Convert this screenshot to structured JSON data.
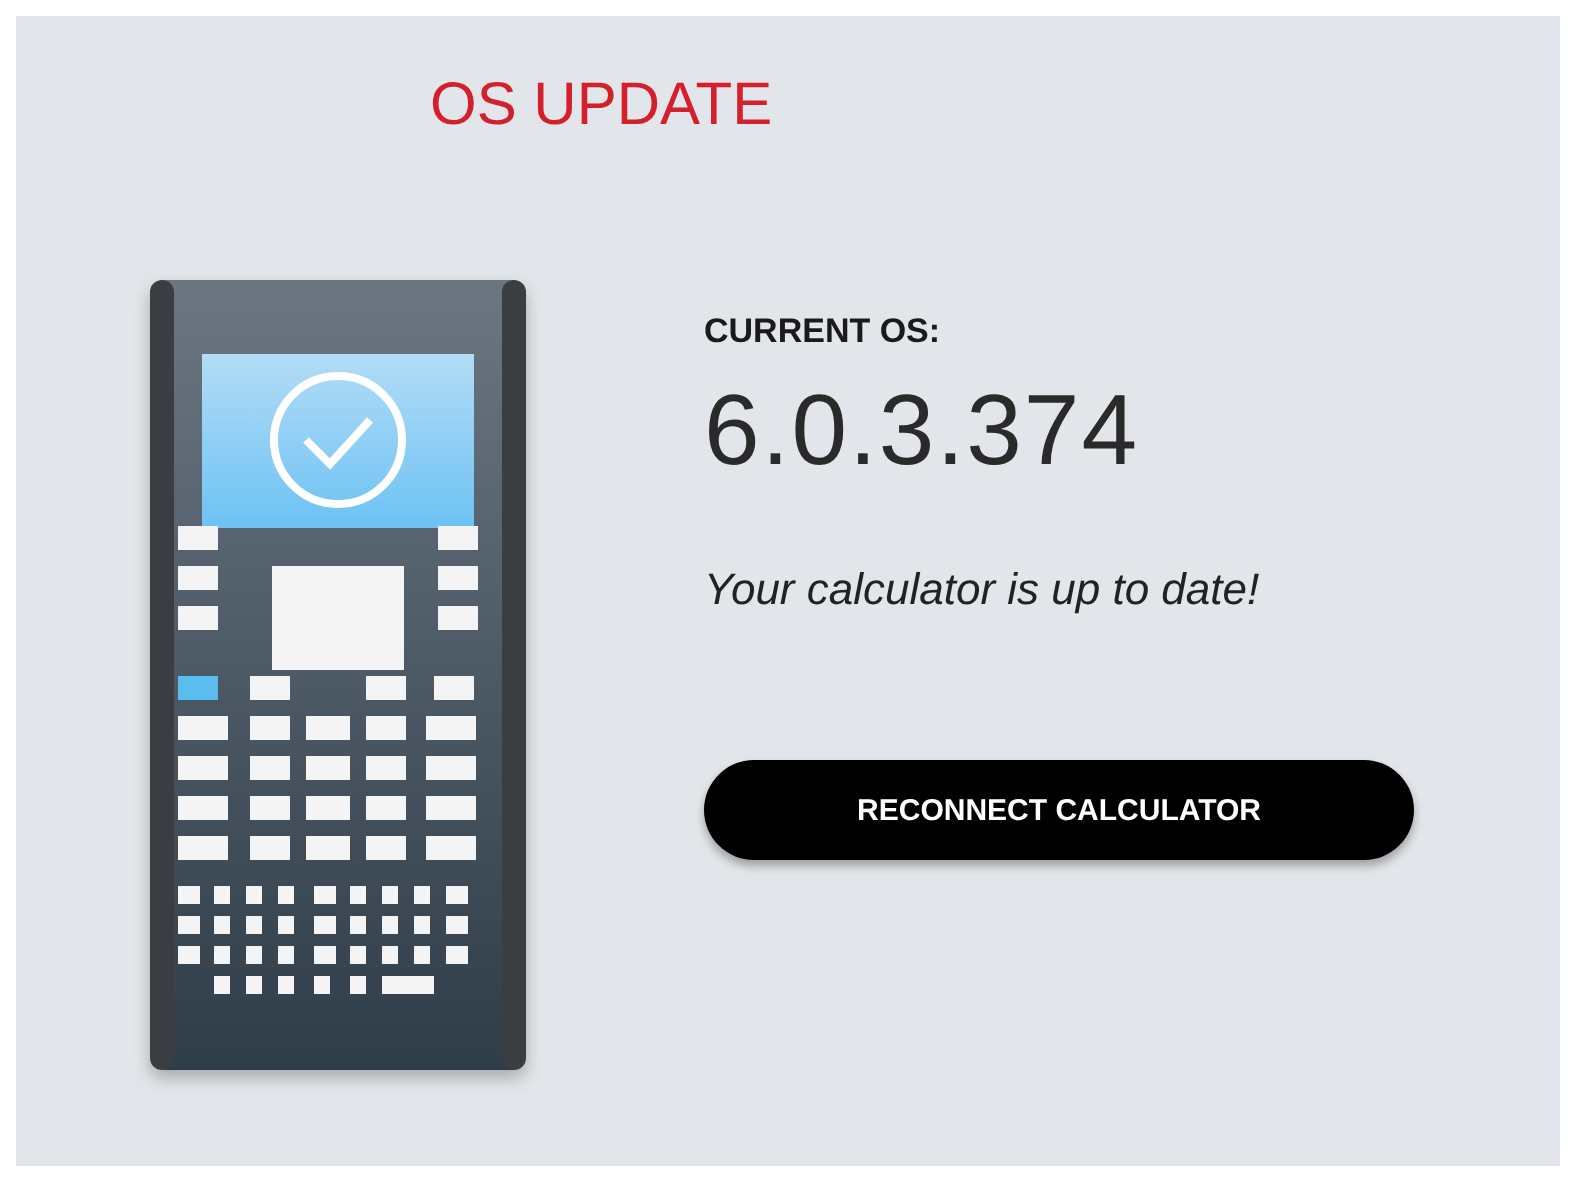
{
  "title": "OS UPDATE",
  "current_os": {
    "label": "CURRENT OS:",
    "version": "6.0.3.374",
    "message": "Your calculator is up to date!"
  },
  "button": {
    "label": "RECONNECT CALCULATOR"
  }
}
